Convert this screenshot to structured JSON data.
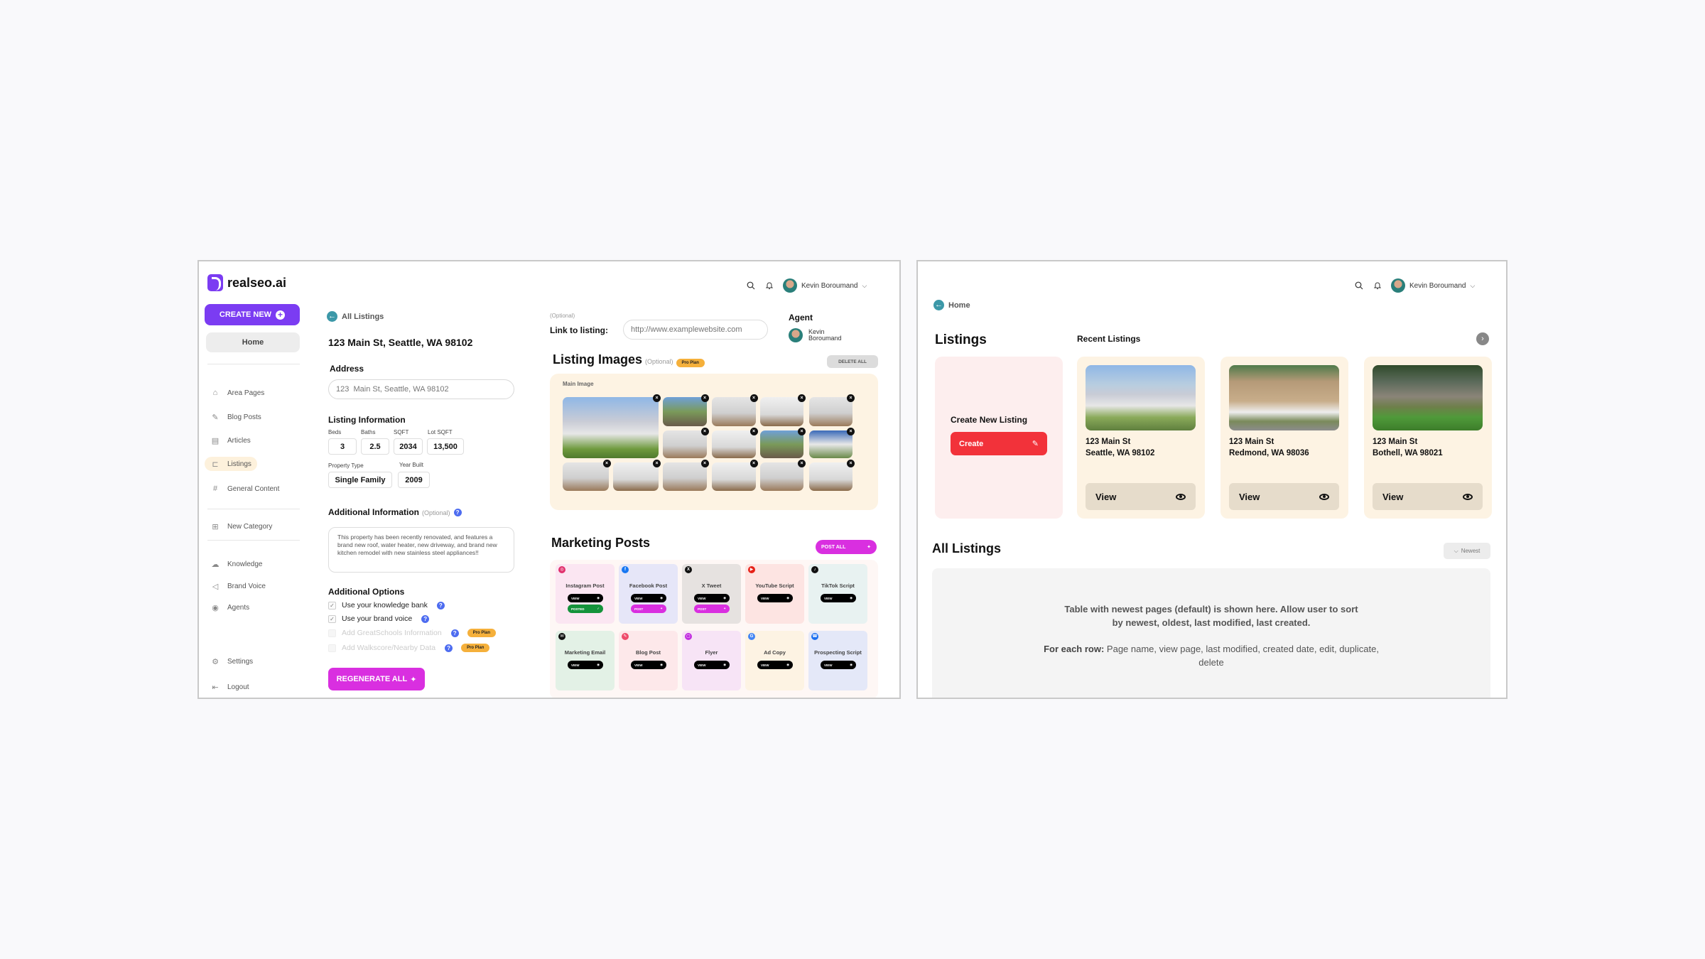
{
  "screenA": {
    "logo": "realseo.ai",
    "sidebar": {
      "create_new": "CREATE NEW",
      "home": "Home",
      "items": [
        {
          "label": "Area Pages",
          "icon": "house-icon"
        },
        {
          "label": "Blog Posts",
          "icon": "edit-doc-icon"
        },
        {
          "label": "Articles",
          "icon": "document-icon"
        },
        {
          "label": "Listings",
          "icon": "sign-icon",
          "active": true
        },
        {
          "label": "General Content",
          "icon": "hashtag-icon"
        },
        {
          "label": "New Category",
          "icon": "plus-box-icon"
        },
        {
          "label": "Knowledge",
          "icon": "brain-icon"
        },
        {
          "label": "Brand Voice",
          "icon": "megaphone-icon"
        },
        {
          "label": "Agents",
          "icon": "user-circle-icon"
        },
        {
          "label": "Settings",
          "icon": "gear-icon"
        },
        {
          "label": "Logout",
          "icon": "logout-icon"
        }
      ]
    },
    "header": {
      "user_name": "Kevin Boroumand"
    },
    "back_link": "All Listings",
    "page_title": "123 Main St, Seattle, WA 98102",
    "address": {
      "label": "Address",
      "value": "123  Main St, Seattle, WA 98102"
    },
    "listing_info": {
      "title": "Listing Information",
      "fields": [
        {
          "label": "Beds",
          "value": "3"
        },
        {
          "label": "Baths",
          "value": "2.5"
        },
        {
          "label": "SQFT",
          "value": "2034"
        },
        {
          "label": "Lot SQFT",
          "value": "13,500"
        },
        {
          "label": "Property Type",
          "value": "Single Family"
        },
        {
          "label": "Year Built",
          "value": "2009"
        }
      ]
    },
    "additional_info": {
      "title": "Additional Information",
      "optional": "(Optional)",
      "text": "This property has been recently renovated, and features a brand new roof, water heater, new driveway, and brand new kitchen remodel with new stainless steel appliances!!"
    },
    "additional_options": {
      "title": "Additional Options",
      "options": [
        {
          "label": "Use your knowledge bank",
          "checked": true,
          "enabled": true
        },
        {
          "label": "Use your brand voice",
          "checked": true,
          "enabled": true
        },
        {
          "label": "Add GreatSchools Information",
          "checked": false,
          "enabled": false,
          "badge": "Pro Plan"
        },
        {
          "label": "Add Walkscore/Nearby Data",
          "checked": false,
          "enabled": false,
          "badge": "Pro Plan"
        }
      ]
    },
    "regenerate": "REGENERATE ALL",
    "link": {
      "optional": "(Optional)",
      "label": "Link to listing:",
      "placeholder": "http://www.examplewebsite.com"
    },
    "agent": {
      "label": "Agent",
      "first": "Kevin",
      "last": "Boroumand"
    },
    "images": {
      "title": "Listing Images",
      "optional": "(Optional)",
      "badge": "Pro Plan",
      "delete_all": "DELETE ALL",
      "main_label": "Main Image",
      "count": 15
    },
    "marketing": {
      "title": "Marketing Posts",
      "post_all": "POST ALL",
      "cards": [
        {
          "title": "Instagram Post",
          "icon": "instagram-icon",
          "bg": "#fbe6f2",
          "iconColor": "#e1306c",
          "buttons": [
            "VIEW",
            "POSTED"
          ]
        },
        {
          "title": "Facebook Post",
          "icon": "facebook-icon",
          "bg": "#e6e6f8",
          "iconColor": "#1877f2",
          "buttons": [
            "VIEW",
            "POST"
          ]
        },
        {
          "title": "X Tweet",
          "icon": "x-icon",
          "bg": "#e6e2e0",
          "iconColor": "#111111",
          "buttons": [
            "VIEW",
            "POST"
          ]
        },
        {
          "title": "YouTube Script",
          "icon": "youtube-icon",
          "bg": "#fde4e2",
          "iconColor": "#e62117",
          "buttons": [
            "VIEW"
          ]
        },
        {
          "title": "TikTok Script",
          "icon": "tiktok-icon",
          "bg": "#e8f2f1",
          "iconColor": "#111111",
          "buttons": [
            "VIEW"
          ]
        },
        {
          "title": "Marketing Email",
          "icon": "email-icon",
          "bg": "#e3f1e6",
          "iconColor": "#111111",
          "buttons": [
            "VIEW"
          ]
        },
        {
          "title": "Blog Post",
          "icon": "blog-icon",
          "bg": "#fde8ea",
          "iconColor": "#ee4a6a",
          "buttons": [
            "VIEW"
          ]
        },
        {
          "title": "Flyer",
          "icon": "flyer-icon",
          "bg": "#f7e4f6",
          "iconColor": "#c22fe0",
          "buttons": [
            "VIEW"
          ]
        },
        {
          "title": "Ad Copy",
          "icon": "google-icon",
          "bg": "#fdf3e3",
          "iconColor": "#4285f4",
          "buttons": [
            "VIEW"
          ]
        },
        {
          "title": "Prospecting Script",
          "icon": "phone-icon",
          "bg": "#e4e8f8",
          "iconColor": "#1a6ff0",
          "buttons": [
            "VIEW"
          ]
        }
      ]
    }
  },
  "screenB": {
    "header": {
      "user_name": "Kevin Boroumand"
    },
    "back_link": "Home",
    "title": "Listings",
    "recent_title": "Recent Listings",
    "create_card": {
      "title": "Create New Listing",
      "button": "Create"
    },
    "recent": [
      {
        "street": "123 Main St",
        "city": "Seattle, WA 98102",
        "view": "View"
      },
      {
        "street": "123 Main St",
        "city": "Redmond, WA 98036",
        "view": "View"
      },
      {
        "street": "123 Main St",
        "city": "Bothell, WA 98021",
        "view": "View"
      }
    ],
    "all_title": "All Listings",
    "sort": "Newest",
    "placeholder_line1": "Table with newest pages (default) is shown here. Allow user to sort by newest, oldest, last modified, last created.",
    "placeholder_bold": "For each row:",
    "placeholder_line2": " Page name, view page, last modified, created date, edit, duplicate, delete"
  },
  "colors": {
    "brand": "#7b3cf2",
    "accent_magenta": "#d92fe0",
    "create_red": "#f2323a",
    "back_teal": "#3c98a8",
    "pro_badge": "#f5b03b",
    "posted_green": "#14933b"
  }
}
